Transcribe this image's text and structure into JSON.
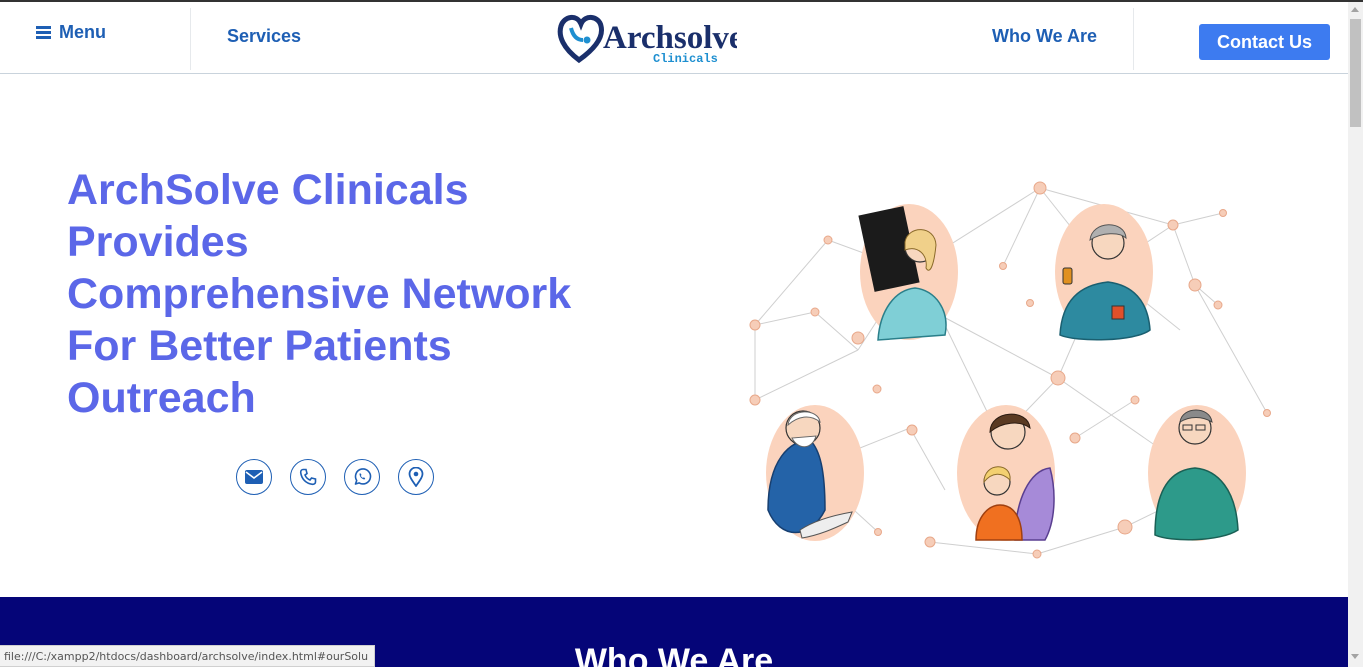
{
  "header": {
    "menu_label": "Menu",
    "nav_services": "Services",
    "logo_main": "Archsolve",
    "logo_sub": "Clinicals",
    "nav_who": "Who We Are",
    "contact_label": "Contact Us"
  },
  "hero": {
    "title_lines": [
      "ArchSolve Clinicals",
      "Provides",
      "Comprehensive Network",
      "For Better Patients",
      "Outreach"
    ],
    "social_icons": [
      "envelope-icon",
      "phone-icon",
      "whatsapp-icon",
      "location-pin-icon"
    ]
  },
  "section": {
    "who_title": "Who We Are"
  },
  "status": {
    "url": "file:///C:/xampp2/htdocs/dashboard/archsolve/index.html#ourSolu"
  },
  "colors": {
    "accent": "#5b67e8",
    "nav": "#1e5fb4",
    "button": "#3d7bf0",
    "band": "#050578"
  }
}
